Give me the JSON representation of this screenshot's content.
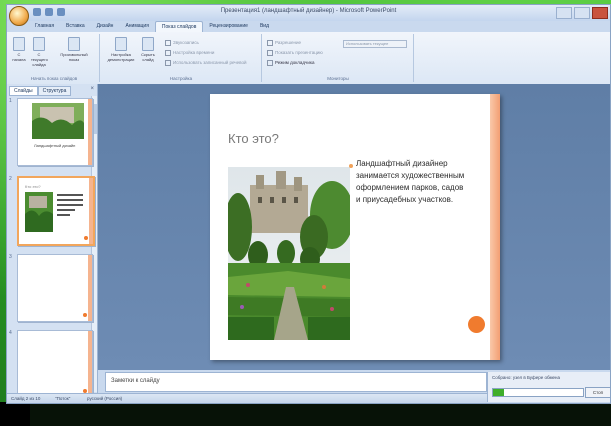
{
  "window": {
    "title": "Презентация1 (ландшафтный дизайнер) - Microsoft PowerPoint"
  },
  "ribbon": {
    "tabs": [
      {
        "label": "Главная",
        "active": false
      },
      {
        "label": "Вставка",
        "active": false
      },
      {
        "label": "Дизайн",
        "active": false
      },
      {
        "label": "Анимация",
        "active": false
      },
      {
        "label": "Показ слайдов",
        "active": true
      },
      {
        "label": "Рецензирование",
        "active": false
      },
      {
        "label": "Вид",
        "active": false
      }
    ],
    "groups": {
      "start_show": {
        "label": "Начать показ слайдов",
        "buttons": [
          "С начала",
          "С текущего слайда",
          "Произвольный показ"
        ]
      },
      "setup": {
        "label": "Настройка",
        "buttons": [
          "Настройка демонстрации",
          "Скрыть слайд"
        ],
        "checks": [
          "Звукозапись",
          "Настройка времени",
          "Использовать записанный речевой"
        ]
      },
      "monitors": {
        "label": "Мониторы",
        "checks": [
          "Разрешение",
          "Показать презентацию",
          "Режим докладчика"
        ],
        "dropdown": "Использовать текущее"
      }
    }
  },
  "left_pane": {
    "tabs": [
      "Слайды",
      "Структура"
    ],
    "slides": [
      {
        "number": "1",
        "caption": "Ландшафтный дизайн",
        "selected": false
      },
      {
        "number": "2",
        "caption": "Кто это?",
        "selected": true
      },
      {
        "number": "3",
        "caption": "",
        "selected": false
      },
      {
        "number": "4",
        "caption": "",
        "selected": false
      }
    ]
  },
  "slide": {
    "title": "Кто это?",
    "bullet": "Ландшафтный дизайнер занимается художественным оформлением парков, садов и приусадебных участков."
  },
  "notes": {
    "placeholder": "Заметки к слайду"
  },
  "clipboard": {
    "status": "Собрано: узел в Буфере обмена",
    "stop_label": "Стоп",
    "progress": 0.12
  },
  "statusbar": {
    "slide_info": "Слайд 2 из 10",
    "theme": "\"Поток\"",
    "language": "русский (Россия)"
  },
  "colors": {
    "accent_orange": "#f07b2e",
    "slide_bar": "#f39f73",
    "background_green": "#2a9a24"
  }
}
